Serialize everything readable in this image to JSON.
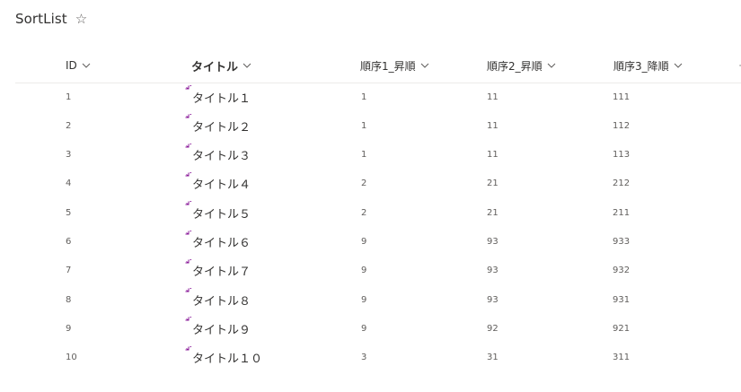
{
  "list": {
    "title": "SortList",
    "favorite_icon": "star-outline-icon"
  },
  "columns": [
    {
      "key": "id",
      "label": "ID"
    },
    {
      "key": "title",
      "label": "タイトル"
    },
    {
      "key": "order1",
      "label": "順序1_昇順"
    },
    {
      "key": "order2",
      "label": "順序2_昇順"
    },
    {
      "key": "order3",
      "label": "順序3_降順"
    }
  ],
  "icons": {
    "column_menu": "chevron-down-icon",
    "new_item": "new-item-sparkle-icon"
  },
  "colors": {
    "new_item_icon": "#881798",
    "divider": "#edebe9"
  },
  "rows": [
    {
      "id": "1",
      "title": "タイトル１",
      "order1": "1",
      "order2": "11",
      "order3": "111"
    },
    {
      "id": "2",
      "title": "タイトル２",
      "order1": "1",
      "order2": "11",
      "order3": "112"
    },
    {
      "id": "3",
      "title": "タイトル３",
      "order1": "1",
      "order2": "11",
      "order3": "113"
    },
    {
      "id": "4",
      "title": "タイトル４",
      "order1": "2",
      "order2": "21",
      "order3": "212"
    },
    {
      "id": "5",
      "title": "タイトル５",
      "order1": "2",
      "order2": "21",
      "order3": "211"
    },
    {
      "id": "6",
      "title": "タイトル６",
      "order1": "9",
      "order2": "93",
      "order3": "933"
    },
    {
      "id": "7",
      "title": "タイトル７",
      "order1": "9",
      "order2": "93",
      "order3": "932"
    },
    {
      "id": "8",
      "title": "タイトル８",
      "order1": "9",
      "order2": "93",
      "order3": "931"
    },
    {
      "id": "9",
      "title": "タイトル９",
      "order1": "9",
      "order2": "92",
      "order3": "921"
    },
    {
      "id": "10",
      "title": "タイトル１０",
      "order1": "3",
      "order2": "31",
      "order3": "311"
    }
  ]
}
